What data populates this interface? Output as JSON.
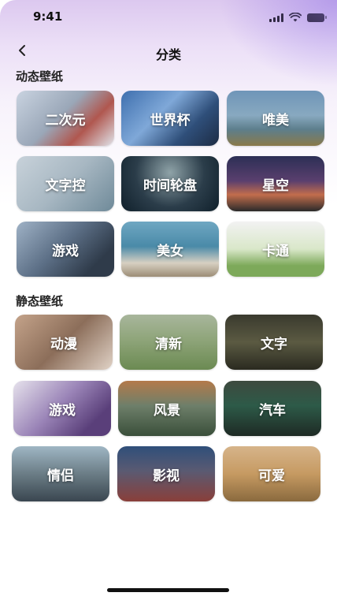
{
  "status_bar": {
    "time": "9:41"
  },
  "nav": {
    "title": "分类"
  },
  "dynamic": {
    "title": "动态壁纸",
    "items": [
      {
        "label": "二次元",
        "bg": "linear-gradient(135deg,#c9d3e0,#9aa7b8 45%,#b0574f 70%,#e0e4ea)"
      },
      {
        "label": "世界杯",
        "bg": "linear-gradient(135deg,#3e6fae,#7fa8d8 40%,#2f4f7a 70%,#1d2c44)"
      },
      {
        "label": "唯美",
        "bg": "linear-gradient(180deg,#6f95b8,#88a9c0 45%,#5d7e8c 70%,#8a7a4a)"
      },
      {
        "label": "文字控",
        "bg": "linear-gradient(135deg,#c8d2da,#a7b7c2 50%,#6f8a99 100%)"
      },
      {
        "label": "时间轮盘",
        "bg": "radial-gradient(circle at 50% 30%,#8fa3a8,#2b3d4a 55%,#10202b)"
      },
      {
        "label": "星空",
        "bg": "linear-gradient(180deg,#2c2f55,#5a3f6e 45%,#c26d4c 70%,#2a2a2a)"
      },
      {
        "label": "游戏",
        "bg": "linear-gradient(135deg,#9fb2c6,#5c6f86 45%,#2f3b4a 80%)"
      },
      {
        "label": "美女",
        "bg": "linear-gradient(180deg,#6fa7c2,#4a8aa8 45%,#d7d0c2 75%,#9c8d76)"
      },
      {
        "label": "卡通",
        "bg": "linear-gradient(180deg,#f2f2f2,#d9e7c9 50%,#7da95a 80%)"
      }
    ]
  },
  "static": {
    "title": "静态壁纸",
    "items": [
      {
        "label": "动漫",
        "bg": "linear-gradient(135deg,#c4a38a,#8c6e5a 50%,#e0d2c6)"
      },
      {
        "label": "清新",
        "bg": "linear-gradient(180deg,#a8b69c,#8fa57a 45%,#6b8a52 100%)"
      },
      {
        "label": "文字",
        "bg": "linear-gradient(180deg,#3a3a2e,#5b5a42 50%,#2a2a20)"
      },
      {
        "label": "游戏",
        "bg": "linear-gradient(135deg,#e6e2ec,#9b85b8 45%,#5a3f7a 80%)"
      },
      {
        "label": "风景",
        "bg": "linear-gradient(180deg,#b47a4a,#6e7f6a 45%,#3a4f3a 100%)"
      },
      {
        "label": "汽车",
        "bg": "linear-gradient(180deg,#3e4a3f,#2d5a48 45%,#1e2a24 100%)"
      },
      {
        "label": "情侣",
        "bg": "linear-gradient(180deg,#9fb6c4,#6b7d86 50%,#3a4650 100%)"
      },
      {
        "label": "影视",
        "bg": "linear-gradient(180deg,#2f4f7a,#5a5a72 45%,#8a3f3a 100%)"
      },
      {
        "label": "可爱",
        "bg": "linear-gradient(180deg,#d6b48a,#c69a62 50%,#8a6a3e 100%)"
      }
    ]
  },
  "colors": {
    "accent": "#9b86e6",
    "text": "#111111"
  }
}
